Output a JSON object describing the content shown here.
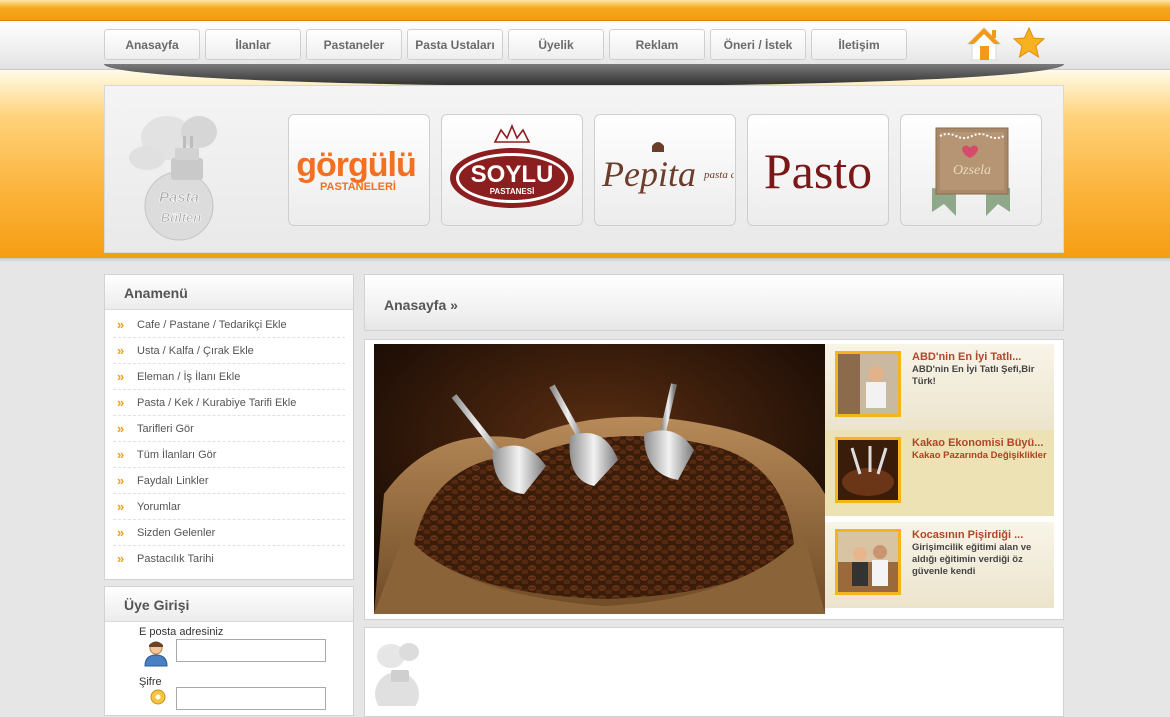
{
  "nav": {
    "items": [
      "Anasayfa",
      "İlanlar",
      "Pastaneler",
      "Pasta Ustaları",
      "Üyelik",
      "Reklam",
      "Öneri / İstek",
      "İletişim"
    ]
  },
  "banner": {
    "logo_text": [
      "Pasta",
      "Bülten"
    ],
    "brands": [
      {
        "line1": "görgülü",
        "line2": "PASTANELERİ"
      },
      {
        "line1": "SOYLU",
        "line2": "PASTANESİ"
      },
      {
        "line1": "Pepita",
        "line2": "pasta cafe"
      },
      {
        "line1": "Pasto",
        "line2": ""
      },
      {
        "line1": "Ozsela",
        "line2": ""
      }
    ]
  },
  "sidebar": {
    "menu_title": "Anamenü",
    "arrow": "»",
    "items": [
      "Cafe / Pastane / Tedarikçi Ekle",
      "Usta / Kalfa / Çırak Ekle",
      "Eleman / İş İlanı Ekle",
      "Pasta / Kek / Kurabiye Tarifi Ekle",
      "Tarifleri Gör",
      "Tüm İlanları Gör",
      "Faydalı Linkler",
      "Yorumlar",
      "Sizden Gelenler",
      "Pastacılık Tarihi"
    ],
    "login": {
      "title": "Üye Girişi",
      "email_label": "E posta adresiniz",
      "email_value": "",
      "password_label": "Şifre",
      "password_value": ""
    }
  },
  "main": {
    "breadcrumb": "Anasayfa »",
    "news": [
      {
        "title": "ABD'nin En İyi Tatlı...",
        "desc": "ABD'nin En İyi Tatlı Şefi,Bir Türk!"
      },
      {
        "title": "Kakao Ekonomisi Büyü...",
        "desc": "Kakao Pazarında Değişiklikler"
      },
      {
        "title": "Kocasının Pişirdiği ...",
        "desc": "Girişimcilik eğitimi alan ve aldığı eğitimin verdiği öz güvenle kendi"
      }
    ]
  },
  "colors": {
    "accent": "#f5a01a",
    "news_title": "#b0462a",
    "active_news_bg": "#f0e6b8"
  }
}
